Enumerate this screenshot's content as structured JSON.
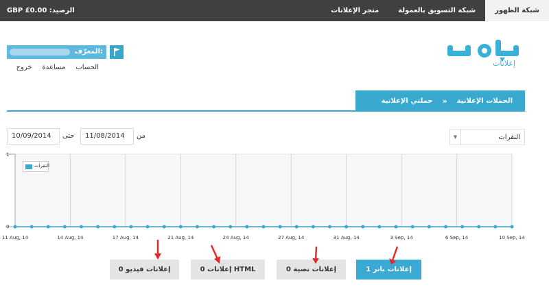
{
  "topbar": {
    "balance": "GBP £0.00 :الرصيد",
    "nav": [
      {
        "label": "شبكة الظهور",
        "active": true
      },
      {
        "label": "شبكة التسويق بالعمولة",
        "active": false
      },
      {
        "label": "متجر الإعلانات",
        "active": false
      }
    ]
  },
  "logo": {
    "subtitle": "إعلانات"
  },
  "account": {
    "id_label": "المعرّف:",
    "links": [
      "الحساب",
      "مساعدة",
      "خروج"
    ]
  },
  "breadcrumb": {
    "root": "الحملات الإعلانية",
    "separator": "»",
    "current": "حملتي الإعلانية"
  },
  "filters": {
    "metric": "النقرات",
    "from_label": "من",
    "from_date": "11/08/2014",
    "to_label": "حتى",
    "to_date": "10/09/2014"
  },
  "chart_data": {
    "type": "line",
    "legend": [
      "النقرات"
    ],
    "legend_position": "top-left",
    "ylim": [
      0,
      1
    ],
    "y_ticks": [
      "0",
      "1"
    ],
    "x_ticks": [
      "11 Aug, 14",
      "14 Aug, 14",
      "17 Aug, 14",
      "21 Aug, 14",
      "24 Aug, 14",
      "27 Aug, 14",
      "31 Aug, 14",
      "3 Sep, 14",
      "6 Sep, 14",
      "10 Sep, 14"
    ],
    "series": [
      {
        "name": "النقرات",
        "color": "#39a9cf",
        "values": [
          0,
          0,
          0,
          0,
          0,
          0,
          0,
          0,
          0,
          0,
          0,
          0,
          0,
          0,
          0,
          0,
          0,
          0,
          0,
          0,
          0,
          0,
          0,
          0,
          0,
          0,
          0,
          0,
          0,
          0,
          0
        ]
      }
    ],
    "grid": true
  },
  "tabs": [
    {
      "label": "1 إعلانات بانر",
      "active": true
    },
    {
      "label": "0 إعلانات نصية",
      "active": false
    },
    {
      "label": "0 إعلانات HTML",
      "active": false
    },
    {
      "label": "0 إعلانات فيديو",
      "active": false
    }
  ],
  "colors": {
    "accent": "#39a9cf",
    "topbar": "#404040",
    "arrow": "#e32b2b"
  }
}
